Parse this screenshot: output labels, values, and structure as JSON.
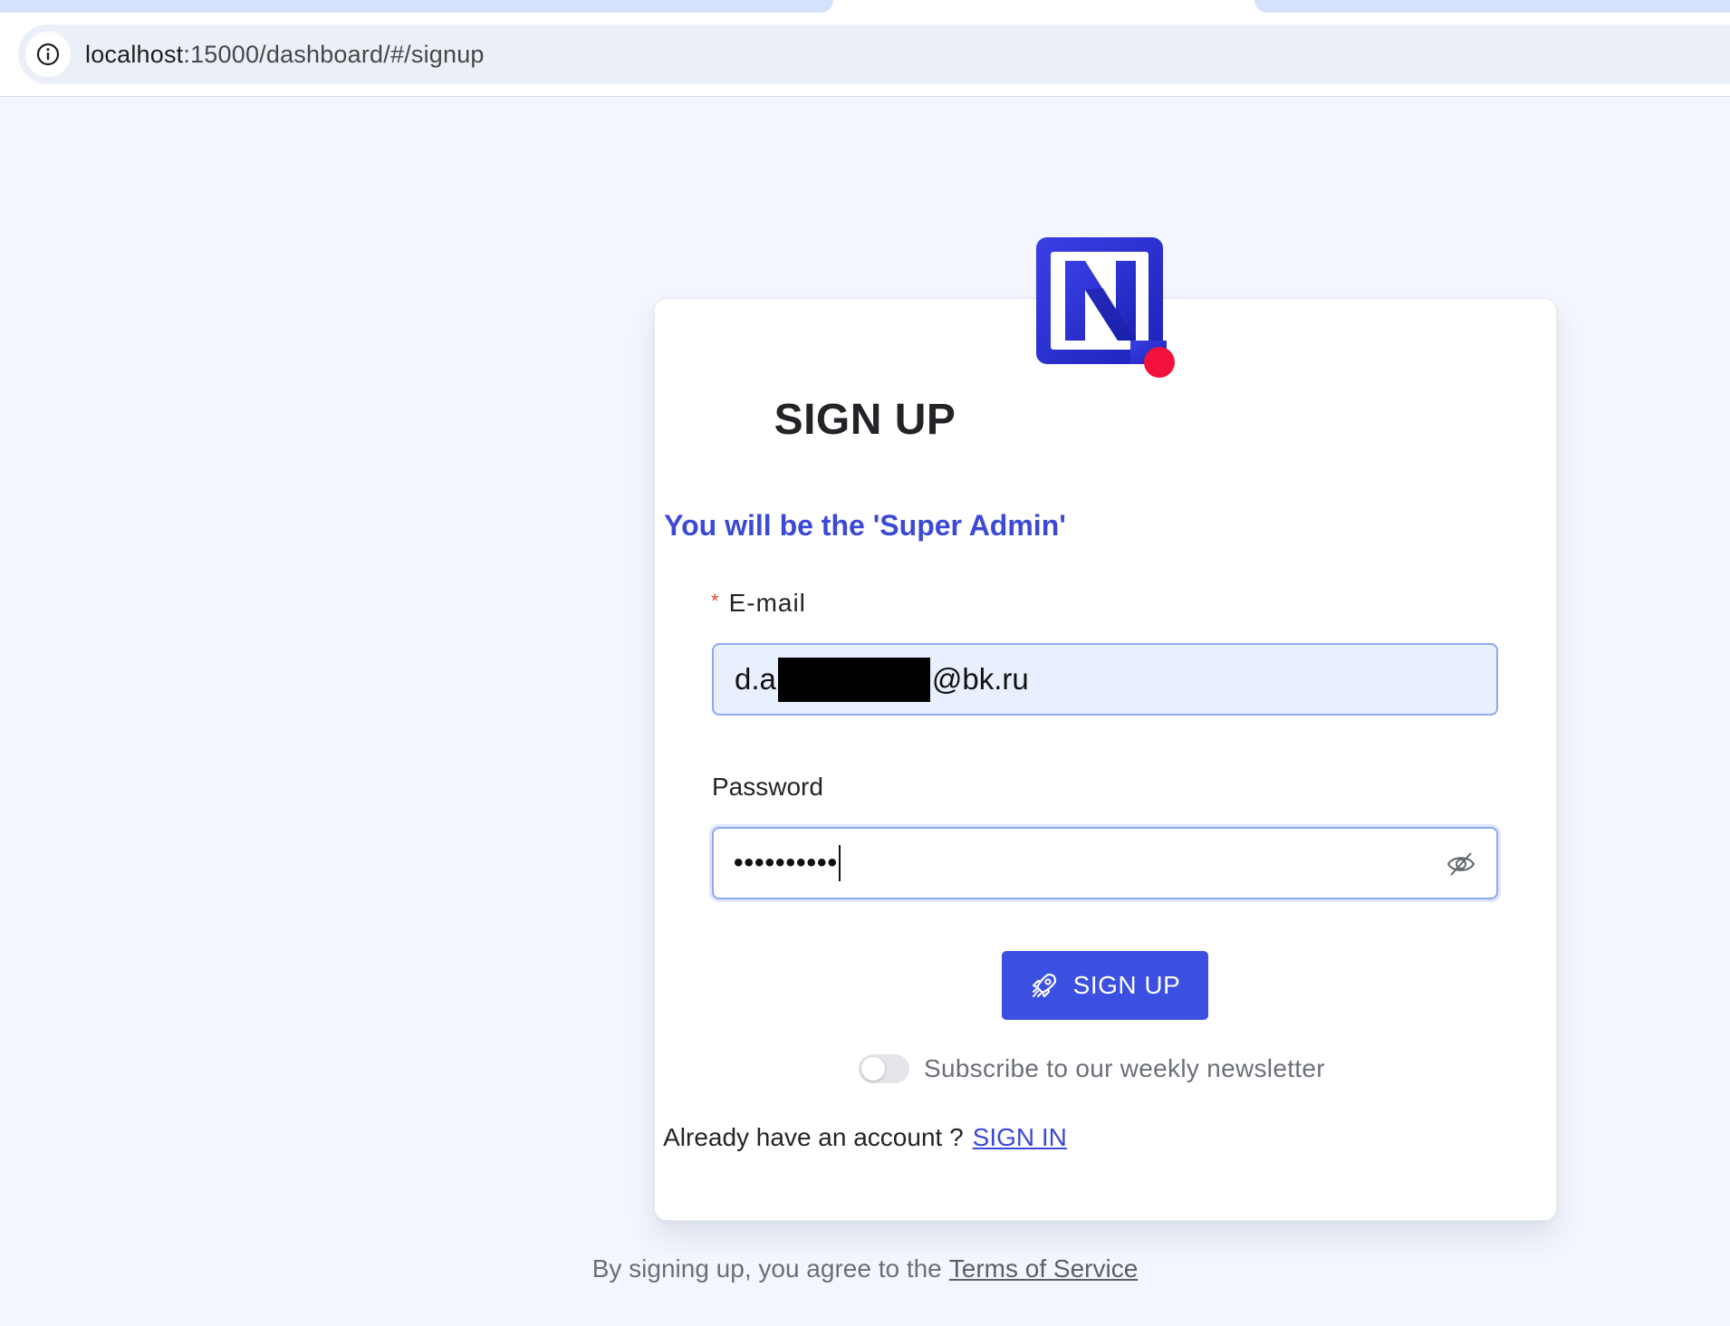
{
  "browser": {
    "url_host": "localhost",
    "url_path": ":15000/dashboard/#/signup"
  },
  "signup": {
    "title": "SIGN UP",
    "subtitle": "You will be the 'Super Admin'",
    "email": {
      "required_mark": "*",
      "label": "E-mail",
      "value_prefix": "d.a",
      "value_suffix": "@bk.ru"
    },
    "password": {
      "label": "Password",
      "masked_value": "••••••••••"
    },
    "submit_label": "SIGN UP",
    "newsletter": {
      "label": "Subscribe to our weekly newsletter",
      "checked": false
    },
    "already_have_account": "Already have an account ?",
    "sign_in_link": "SIGN IN"
  },
  "footer": {
    "terms_prefix": "By signing up, you agree to the",
    "terms_link": "Terms of Service"
  },
  "colors": {
    "accent": "#3b4fe0",
    "logo_blue": "#2a32d6",
    "logo_dot": "#f2123d",
    "page_background": "#f4f6fd"
  }
}
